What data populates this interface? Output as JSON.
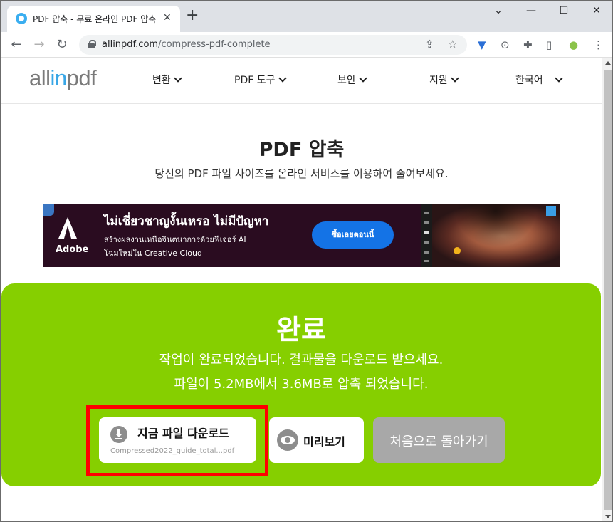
{
  "browser": {
    "tab_title": "PDF 압축 - 무료 온라인 PDF 압축",
    "tab_close": "✕",
    "new_tab": "+",
    "url_host": "allinpdf.com",
    "url_path": "/compress-pdf-complete",
    "window_buttons": {
      "chevron": "⌄",
      "minimize": "—",
      "maximize": "☐",
      "close": "✕"
    }
  },
  "site": {
    "logo_part1": "all",
    "logo_part2": "in",
    "logo_part3": "pdf",
    "menu": [
      {
        "label": "변환"
      },
      {
        "label": "PDF 도구"
      },
      {
        "label": "보안"
      },
      {
        "label": "지원"
      },
      {
        "label": "한국어"
      }
    ]
  },
  "main": {
    "title": "PDF 압축",
    "subtitle": "당신의 PDF 파일 사이즈를 온라인 서비스를 이용하여 줄여보세요."
  },
  "ad": {
    "brand": "Adobe",
    "headline": "ไม่เชี่ยวชาญงั้นเหรอ ไม่มีปัญหา",
    "line1": "สร้างผลงานเหนือจินตนาการด้วยฟีเจอร์ AI",
    "line2": "โฉมใหม่ใน Creative Cloud",
    "cta": "ซื้อเลยตอนนี้"
  },
  "result": {
    "title": "완료",
    "message1": "작업이 완료되었습니다. 결과물을 다운로드 받으세요.",
    "message2": "파일이 5.2MB에서 3.6MB로 압축 되었습니다.",
    "download_label": "지금 파일 다운로드",
    "file_name": "Compressed2022_guide_total...pdf",
    "preview_label": "미리보기",
    "back_label": "처음으로 돌아가기"
  },
  "colors": {
    "accent_green": "#86cf00",
    "logo_blue": "#38a6e6",
    "highlight_red": "#ff0000",
    "cta_blue": "#1473e6"
  }
}
